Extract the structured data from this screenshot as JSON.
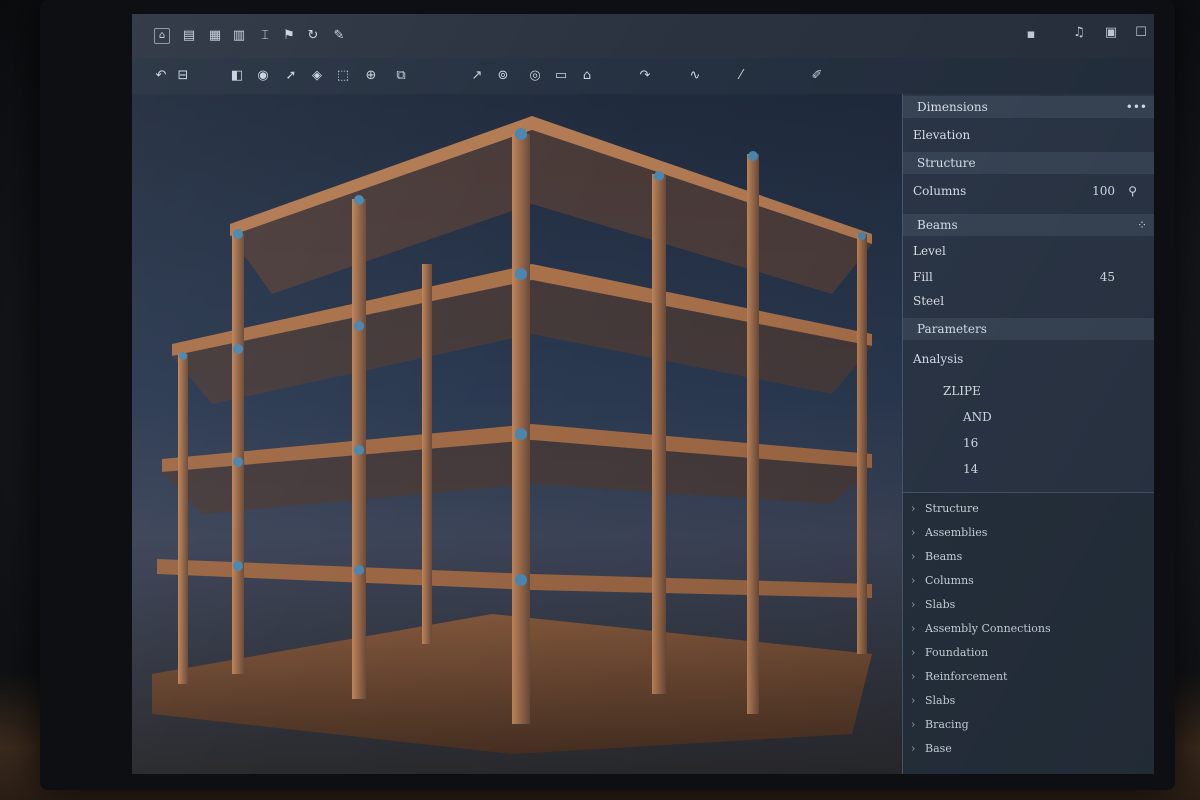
{
  "toolbar": {
    "top_icons": [
      "home-icon",
      "layers-icon",
      "grid-icon",
      "chart-icon",
      "ruler-icon",
      "tag-icon",
      "refresh-icon",
      "pen-icon"
    ],
    "second_icons": [
      "undo-icon",
      "lock-icon",
      "copy-icon",
      "camera-icon",
      "cursor-icon",
      "drop-icon",
      "fit-icon",
      "tag-icon",
      "layers-icon",
      "eye-icon",
      "box-icon",
      "home-icon",
      "arrow-icon",
      "arrow-icon",
      "pin-icon",
      "line-icon"
    ],
    "window_icons": [
      "minimize-icon",
      "music-icon",
      "save-icon",
      "window-icon"
    ]
  },
  "properties": {
    "rows": [
      {
        "label": "Dimensions",
        "value": "",
        "header": true
      },
      {
        "label": "Elevation",
        "value": "",
        "header": false
      },
      {
        "label": "Structure",
        "value": "",
        "header": true
      },
      {
        "label": "Columns",
        "value": "100",
        "header": false,
        "icon": "search-icon"
      },
      {
        "label": "Beams",
        "value": "",
        "header": true
      },
      {
        "label": "Level",
        "value": "",
        "header": false
      },
      {
        "label": "Fill",
        "value": "45",
        "header": false
      },
      {
        "label": "Steel",
        "value": "",
        "header": false
      },
      {
        "label": "Parameters",
        "value": "",
        "header": true
      },
      {
        "label": "Analysis",
        "value": "",
        "header": false
      },
      {
        "label": "ZLIPE",
        "value": "",
        "header": false
      },
      {
        "label": "AND",
        "value": "",
        "header": false
      },
      {
        "label": "16",
        "value": "",
        "header": false
      },
      {
        "label": "14",
        "value": "",
        "header": false
      }
    ]
  },
  "tree": {
    "items": [
      "Structure",
      "Assemblies",
      "Beams",
      "Columns",
      "Slabs",
      "Assembly Connections",
      "Foundation",
      "Reinforcement",
      "Slabs",
      "Bracing",
      "Base"
    ]
  },
  "colors": {
    "accent": "#3d5f80",
    "beam": "#b07850",
    "joint": "#4a87b0"
  }
}
